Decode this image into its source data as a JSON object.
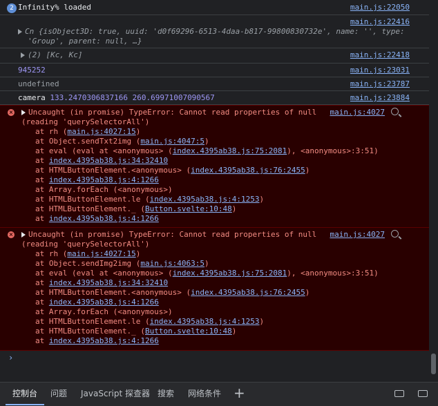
{
  "console": {
    "rows": [
      {
        "badge": "2",
        "text": "Infinity% loaded",
        "src": "main.js:22050"
      },
      {
        "src": "main.js:22416",
        "object_line1": "Cn {isObject3D: true, uuid: 'd0f69296-6513-4daa-b817-99800830732e', name: '', type:",
        "object_line2": "'Group', parent: null, …}"
      },
      {
        "text": "(2) [Kc, Kc]",
        "src": "main.js:22418"
      },
      {
        "text": "945252",
        "src": "main.js:23031"
      },
      {
        "text": "undefined",
        "src": "main.js:23787"
      },
      {
        "label": "camera",
        "value1": "133.2470306837166",
        "value2": "260.69971007090567",
        "src": "main.js:23884"
      }
    ],
    "errors": [
      {
        "line1": "Uncaught (in promise) TypeError: Cannot read properties of null",
        "line2": "(reading 'querySelectorAll')",
        "src": "main.js:4027",
        "stack": [
          {
            "pre": "at rh (",
            "link": "main.js:4027:15",
            "post": ")"
          },
          {
            "pre": "at Object.sendTxt2img (",
            "link": "main.js:4047:5",
            "post": ")"
          },
          {
            "pre": "at eval (eval at <anonymous> (",
            "link": "index.4395ab38.js:75:2081",
            "post": "), <anonymous>:3:51)"
          },
          {
            "pre": "at ",
            "link": "index.4395ab38.js:34:32410",
            "post": ""
          },
          {
            "pre": "at HTMLButtonElement.<anonymous> (",
            "link": "index.4395ab38.js:76:2455",
            "post": ")"
          },
          {
            "pre": "at ",
            "link": "index.4395ab38.js:4:1266",
            "post": ""
          },
          {
            "pre": "at Array.forEach (<anonymous>)",
            "link": "",
            "post": ""
          },
          {
            "pre": "at HTMLButtonElement.le (",
            "link": "index.4395ab38.js:4:1253",
            "post": ")"
          },
          {
            "pre": "at HTMLButtonElement._ (",
            "link": "Button.svelte:10:48",
            "post": ")"
          },
          {
            "pre": "at ",
            "link": "index.4395ab38.js:4:1266",
            "post": ""
          }
        ]
      },
      {
        "line1": "Uncaught (in promise) TypeError: Cannot read properties of null",
        "line2": "(reading 'querySelectorAll')",
        "src": "main.js:4027",
        "stack": [
          {
            "pre": "at rh (",
            "link": "main.js:4027:15",
            "post": ")"
          },
          {
            "pre": "at Object.sendImg2img (",
            "link": "main.js:4063:5",
            "post": ")"
          },
          {
            "pre": "at eval (eval at <anonymous> (",
            "link": "index.4395ab38.js:75:2081",
            "post": "), <anonymous>:3:51)"
          },
          {
            "pre": "at ",
            "link": "index.4395ab38.js:34:32410",
            "post": ""
          },
          {
            "pre": "at HTMLButtonElement.<anonymous> (",
            "link": "index.4395ab38.js:76:2455",
            "post": ")"
          },
          {
            "pre": "at ",
            "link": "index.4395ab38.js:4:1266",
            "post": ""
          },
          {
            "pre": "at Array.forEach (<anonymous>)",
            "link": "",
            "post": ""
          },
          {
            "pre": "at HTMLButtonElement.le (",
            "link": "index.4395ab38.js:4:1253",
            "post": ")"
          },
          {
            "pre": "at HTMLButtonElement._ (",
            "link": "Button.svelte:10:48",
            "post": ")"
          },
          {
            "pre": "at ",
            "link": "index.4395ab38.js:4:1266",
            "post": ""
          }
        ]
      }
    ],
    "prompt": "›"
  },
  "tabs": [
    "控制台",
    "问题",
    "JavaScript 探查器",
    "搜索",
    "网络条件"
  ],
  "colors": {
    "background": "#202124",
    "error_bg": "#290000",
    "link": "#8ab4f8",
    "error_text": "#f28b82"
  }
}
